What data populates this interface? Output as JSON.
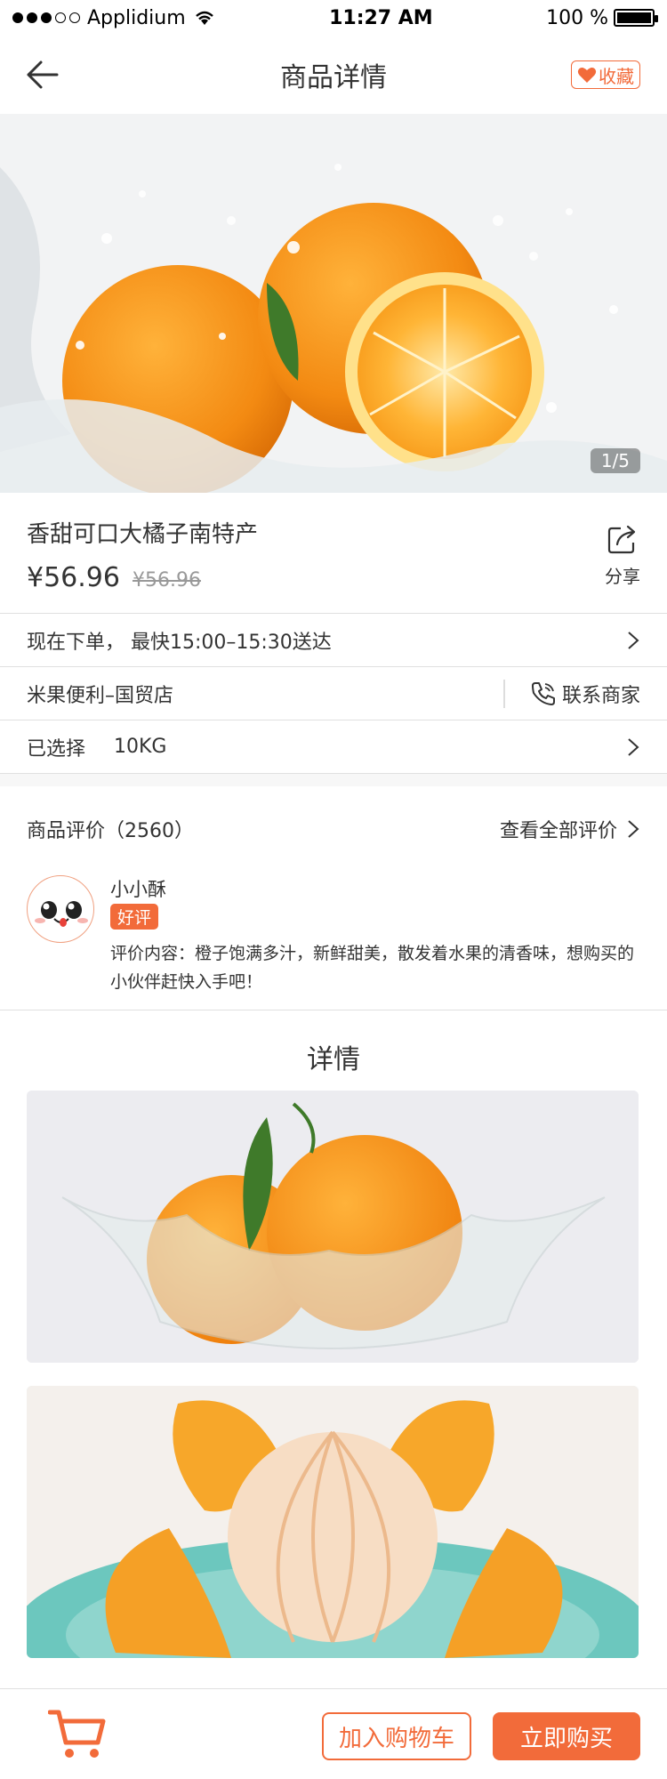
{
  "status_bar": {
    "carrier": "Applidium",
    "time": "11:27 AM",
    "battery": "100 %"
  },
  "nav": {
    "title": "商品详情",
    "favorite_label": "收藏"
  },
  "hero": {
    "pager": "1/5"
  },
  "product": {
    "name": "香甜可口大橘子南特产",
    "price": "¥56.96",
    "original_price": "¥56.96",
    "share_label": "分享"
  },
  "delivery": {
    "text": "现在下单，  最快15:00–15:30送达"
  },
  "store": {
    "name": "米果便利–国贸店",
    "contact_label": "联系商家"
  },
  "spec": {
    "label": "已选择",
    "value": "10KG"
  },
  "review": {
    "title": "商品评价（2560）",
    "view_all": "查看全部评价",
    "reviewer": "小小酥",
    "badge": "好评",
    "content": "评价内容：橙子饱满多汁，新鲜甜美，散发着水果的清香味，想购买的小伙伴赶快入手吧！"
  },
  "details": {
    "title": "详情"
  },
  "bottom": {
    "add_to_cart": "加入购物车",
    "buy_now": "立即购买"
  },
  "colors": {
    "accent": "#f26b3a",
    "divider": "#e0e0e0",
    "text": "#333333"
  },
  "icons": [
    "back-arrow-icon",
    "heart-icon",
    "share-icon",
    "chevron-right-icon",
    "phone-icon",
    "cart-icon"
  ]
}
